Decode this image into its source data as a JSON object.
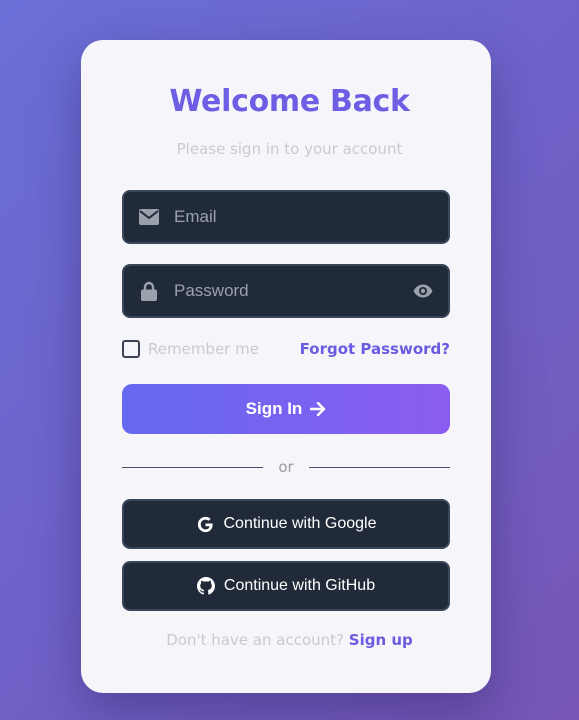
{
  "header": {
    "title": "Welcome Back",
    "subtitle": "Please sign in to your account"
  },
  "form": {
    "email": {
      "placeholder": "Email",
      "value": "",
      "icon": "envelope-icon"
    },
    "password": {
      "placeholder": "Password",
      "value": "",
      "icon": "lock-icon",
      "toggle_icon": "eye-icon"
    },
    "remember_label": "Remember me",
    "remember_checked": false,
    "forgot_label": "Forgot Password?",
    "submit_label": "Sign In",
    "submit_icon": "arrow-right-icon"
  },
  "divider": {
    "label": "or"
  },
  "social": {
    "google_label": "Continue with Google",
    "google_icon": "google-icon",
    "github_label": "Continue with GitHub",
    "github_icon": "github-icon"
  },
  "footer": {
    "prompt": "Don't have an account?",
    "signup_label": "Sign up"
  },
  "colors": {
    "accent": "#6d5ee3",
    "input_bg": "#212a39",
    "card_bg": "#f6f6fa",
    "button_gradient_start": "#6569ef",
    "button_gradient_end": "#8b5cf0"
  }
}
